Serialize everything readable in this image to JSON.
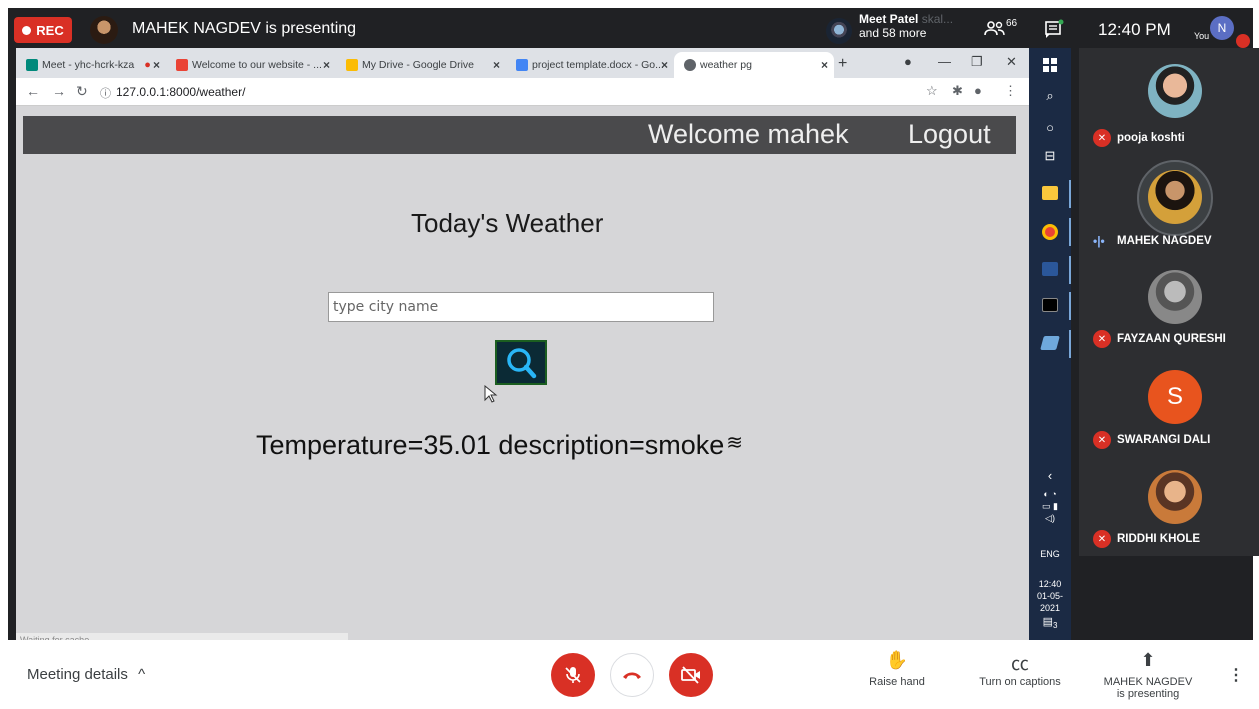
{
  "meet": {
    "rec_label": "REC",
    "presenting_text": "MAHEK NAGDEV is presenting",
    "top_participant_name": "Meet Patel",
    "top_participant_faded": "skal...",
    "top_participant_more": "and 58 more",
    "people_count": "66",
    "clock": "12:40 PM",
    "you_label": "You",
    "you_initial": "N"
  },
  "browser": {
    "tabs": [
      {
        "label": "Meet - yhc-hcrk-kza",
        "icon": "meet-icon",
        "color": "#00897b"
      },
      {
        "label": "Welcome to our website - ...",
        "icon": "gmail-icon",
        "color": "#ea4335"
      },
      {
        "label": "My Drive - Google Drive",
        "icon": "drive-icon",
        "color": "#fbbc04"
      },
      {
        "label": "project template.docx - Go...",
        "icon": "docs-icon",
        "color": "#4285f4"
      },
      {
        "label": "weather pg",
        "icon": "globe-icon",
        "color": "#5f6368"
      }
    ],
    "url_host": "127.0.0.1",
    "url_rest": ":8000/weather/",
    "status_text": "Waiting for cache..."
  },
  "page": {
    "welcome_text": "Welcome mahek",
    "logout_label": "Logout",
    "title": "Today's Weather",
    "city_placeholder": "type city name",
    "result_text": "Temperature=35.01 description=smoke",
    "result_icon": "smoke-icon"
  },
  "taskbar": {
    "lang": "ENG",
    "time": "12:40",
    "date": "01-05-2021",
    "notif_count": "3"
  },
  "participants": [
    {
      "name": "pooja koshti",
      "muted": true
    },
    {
      "name": "MAHEK NAGDEV",
      "muted": false,
      "speaking": true
    },
    {
      "name": "FAYZAAN QURESHI",
      "muted": true
    },
    {
      "name": "SWARANGI DALI",
      "muted": true,
      "initial": "S"
    },
    {
      "name": "RIDDHI KHOLE",
      "muted": true
    }
  ],
  "bottom_bar": {
    "meeting_details": "Meeting details",
    "raise_hand": "Raise hand",
    "captions": "Turn on captions",
    "presenting_line1": "MAHEK NAGDEV",
    "presenting_line2": "is presenting"
  },
  "colors": {
    "meet_dark": "#202124",
    "end_red": "#d93025",
    "page_bg": "#d6d6d8",
    "header_bg": "#4a4a4c",
    "search_btn": "#0b2a35"
  }
}
